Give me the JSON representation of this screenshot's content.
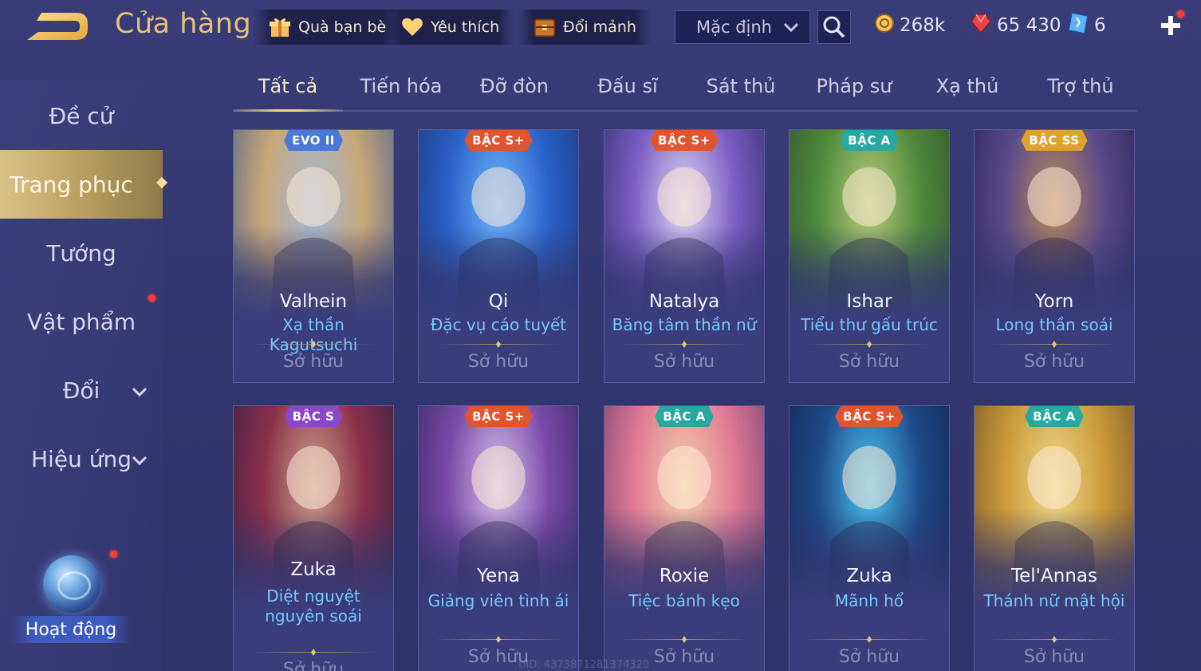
{
  "header": {
    "title": "Cửa hàng",
    "buttons": [
      {
        "label": "Quà bạn bè",
        "icon": "gift-icon"
      },
      {
        "label": "Yêu thích",
        "icon": "heart-icon"
      },
      {
        "label": "Đổi mảnh",
        "icon": "treasure-chest-icon"
      }
    ],
    "sort_value": "Mặc định",
    "currencies": [
      {
        "value": "268k",
        "icon": "gold-coin-icon"
      },
      {
        "value": "65 430",
        "icon": "red-gem-icon"
      },
      {
        "value": "6",
        "icon": "blue-ticket-icon"
      }
    ]
  },
  "sidebar": {
    "items": [
      {
        "label": "Đề cử"
      },
      {
        "label": "Trang phục"
      },
      {
        "label": "Tướng"
      },
      {
        "label": "Vật phẩm"
      },
      {
        "label": "Đổi"
      },
      {
        "label": "Hiệu ứng"
      }
    ],
    "activity_label": "Hoạt động"
  },
  "tabs": [
    "Tất cả",
    "Tiến hóa",
    "Đỡ đòn",
    "Đấu sĩ",
    "Sát thủ",
    "Pháp sư",
    "Xạ thủ",
    "Trợ thủ"
  ],
  "cards": [
    {
      "badge": "EVO II",
      "hero": "Valhein",
      "skin": "Xạ thần Kagutsuchi",
      "status": "Sở hữu",
      "badge_color": "#4a78d8",
      "art": [
        "#9fb9d8",
        "#c9a777",
        "#3b5b8f"
      ]
    },
    {
      "badge": "BẬC S+",
      "hero": "Qi",
      "skin": "Đặc vụ cáo tuyết",
      "status": "Sở hữu",
      "badge_color": "#e0542e",
      "art": [
        "#6fb7ff",
        "#2a62c9",
        "#1b2e6b"
      ]
    },
    {
      "badge": "BẬC S+",
      "hero": "Natalya",
      "skin": "Băng tâm thần nữ",
      "status": "Sở hữu",
      "badge_color": "#e0542e",
      "art": [
        "#dcd6f2",
        "#7b5fc4",
        "#2a2466"
      ]
    },
    {
      "badge": "BẬC A",
      "hero": "Ishar",
      "skin": "Tiểu thư gấu trúc",
      "status": "Sở hữu",
      "badge_color": "#27a8a0",
      "art": [
        "#b9cc7a",
        "#4f8a3e",
        "#2c4a2a"
      ]
    },
    {
      "badge": "BẬC SS",
      "hero": "Yorn",
      "skin": "Long thần soái",
      "status": "Sở hữu",
      "badge_color": "#e0a22e",
      "art": [
        "#b98a5a",
        "#5a4a8a",
        "#241e4a"
      ]
    },
    {
      "badge": "BẬC S",
      "hero": "Zuka",
      "skin": "Diệt nguyệt nguyên soái",
      "status": "Sở hữu",
      "badge_color": "#8a48c8",
      "art": [
        "#c9a08a",
        "#8a2f4a",
        "#2a2046"
      ]
    },
    {
      "badge": "BẬC S+",
      "hero": "Yena",
      "skin": "Giảng viên tình ái",
      "status": "Sở hữu",
      "badge_color": "#e0542e",
      "art": [
        "#d9c0e8",
        "#7a4aa8",
        "#2c2258"
      ]
    },
    {
      "badge": "BẬC A",
      "hero": "Roxie",
      "skin": "Tiệc bánh kẹo",
      "status": "Sở hữu",
      "badge_color": "#27a8a0",
      "art": [
        "#f5d2a8",
        "#e07a96",
        "#6a3a6a"
      ]
    },
    {
      "badge": "BẬC S+",
      "hero": "Zuka",
      "skin": "Mãnh hổ",
      "status": "Sở hữu",
      "badge_color": "#e0542e",
      "art": [
        "#4ac4f0",
        "#1f4a8a",
        "#0f1f44"
      ]
    },
    {
      "badge": "BẬC A",
      "hero": "Tel'Annas",
      "skin": "Thánh nữ mật hội",
      "status": "Sở hữu",
      "badge_color": "#27a8a0",
      "art": [
        "#f0d88a",
        "#c99a3a",
        "#6a4a2a"
      ]
    }
  ],
  "uid_text": "UID: 4373871281374320"
}
